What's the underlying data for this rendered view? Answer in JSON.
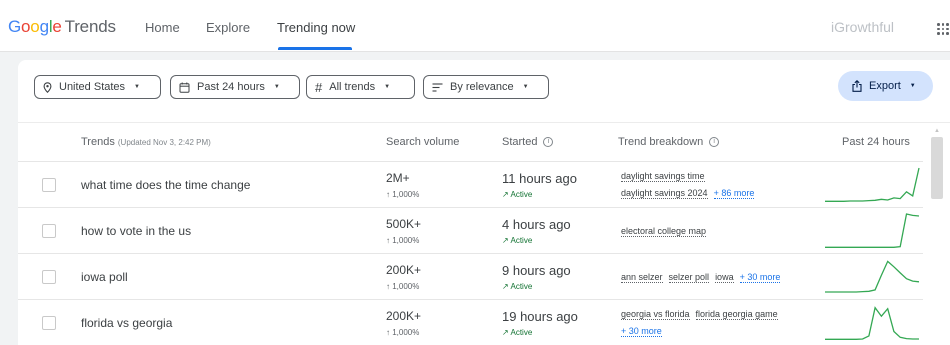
{
  "header": {
    "logo_google": [
      "G",
      "o",
      "o",
      "g",
      "l",
      "e"
    ],
    "logo_trends": "Trends",
    "nav": [
      "Home",
      "Explore",
      "Trending now"
    ],
    "brand": "iGrowthful"
  },
  "filters": {
    "location": "United States",
    "time": "Past 24 hours",
    "category": "All trends",
    "sort": "By relevance",
    "export": "Export"
  },
  "table": {
    "col_trends": "Trends",
    "updated": "(Updated Nov 3, 2:42 PM)",
    "col_volume": "Search volume",
    "col_started": "Started",
    "col_breakdown": "Trend breakdown",
    "col_past": "Past 24 hours",
    "rows": [
      {
        "title": "what time does the time change",
        "volume": "2M+",
        "delta": "↑ 1,000%",
        "started": "11 hours ago",
        "status": "Active",
        "breakdown": [
          "daylight savings time",
          "daylight savings 2024"
        ],
        "more": "+ 86 more",
        "spark": [
          2,
          2,
          2,
          2,
          3,
          3,
          3,
          4,
          5,
          8,
          6,
          12,
          10,
          30,
          18,
          100
        ]
      },
      {
        "title": "how to vote in the us",
        "volume": "500K+",
        "delta": "↑ 1,000%",
        "started": "4 hours ago",
        "status": "Active",
        "breakdown": [
          "electoral college map"
        ],
        "more": "",
        "spark": [
          2,
          2,
          2,
          2,
          2,
          2,
          2,
          2,
          2,
          2,
          2,
          2,
          4,
          100,
          96,
          94
        ]
      },
      {
        "title": "iowa poll",
        "volume": "200K+",
        "delta": "↑ 1,000%",
        "started": "9 hours ago",
        "status": "Active",
        "breakdown": [
          "ann selzer",
          "selzer poll",
          "iowa"
        ],
        "more": "+ 30 more",
        "spark": [
          6,
          6,
          6,
          6,
          6,
          6,
          7,
          8,
          12,
          55,
          96,
          80,
          62,
          45,
          38,
          36
        ]
      },
      {
        "title": "florida vs georgia",
        "volume": "200K+",
        "delta": "↑ 1,000%",
        "started": "19 hours ago",
        "status": "Active",
        "breakdown": [
          "georgia vs florida",
          "florida georgia game"
        ],
        "more": "+ 30 more",
        "spark": [
          2,
          2,
          2,
          2,
          2,
          2,
          3,
          12,
          95,
          70,
          92,
          25,
          8,
          4,
          3,
          3
        ]
      }
    ]
  },
  "colors": {
    "accent": "#1a73e8",
    "spark": "#34a853",
    "export_bg": "#d3e3fd",
    "active": "#137333"
  }
}
